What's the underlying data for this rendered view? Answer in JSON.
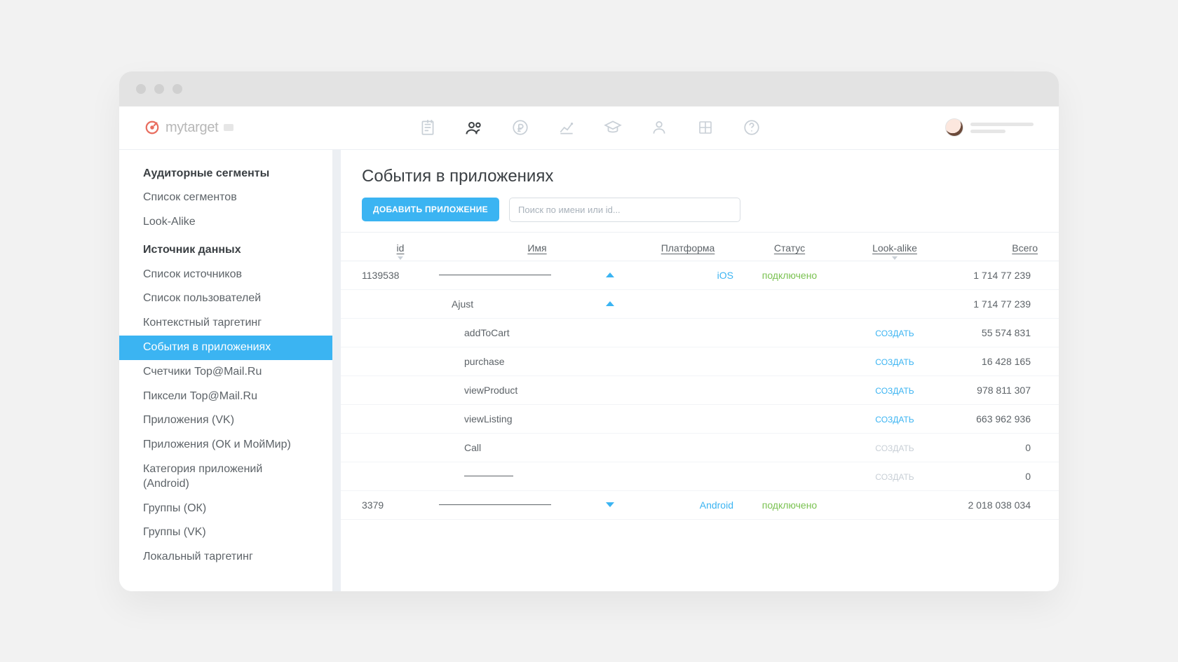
{
  "logo_text": "mytarget",
  "sidebar": {
    "sections": [
      {
        "header": "Аудиторные сегменты",
        "items": [
          "Список сегментов",
          "Look-Alike"
        ]
      },
      {
        "header": "Источник данных",
        "items": [
          "Список источников",
          "Список пользователей",
          "Контекстный таргетинг",
          "События в приложениях",
          "Счетчики Top@Mail.Ru",
          "Пиксели Top@Mail.Ru",
          "Приложения (VK)",
          "Приложения (ОК и МойМир)",
          "Категория приложений (Android)",
          "Группы (ОК)",
          "Группы (VK)",
          "Локальный таргетинг"
        ]
      }
    ],
    "active_item": "События в приложениях"
  },
  "page": {
    "title": "События в приложениях",
    "add_button_label": "ДОБАВИТЬ ПРИЛОЖЕНИЕ",
    "search_placeholder": "Поиск по имени или id..."
  },
  "table": {
    "columns": {
      "id": "id",
      "name": "Имя",
      "platform": "Платформа",
      "status": "Статус",
      "lookalike": "Look-alike",
      "total": "Всего"
    },
    "status_connected": "подключено",
    "create_label": "СОЗДАТЬ",
    "rows": [
      {
        "id": "1139538",
        "name": "",
        "name_line": true,
        "caret": "up",
        "platform": "iOS",
        "status": "подключено",
        "lookalike": "",
        "total": "1 714 77 239",
        "indent": 0
      },
      {
        "id": "",
        "name": "Ajust",
        "caret": "up",
        "platform": "",
        "status": "",
        "lookalike": "",
        "total": "1 714 77 239",
        "indent": 1
      },
      {
        "id": "",
        "name": "addToCart",
        "platform": "",
        "status": "",
        "lookalike": "create",
        "total": "55 574 831",
        "indent": 2
      },
      {
        "id": "",
        "name": "purchase",
        "platform": "",
        "status": "",
        "lookalike": "create",
        "total": "16 428 165",
        "indent": 2
      },
      {
        "id": "",
        "name": "viewProduct",
        "platform": "",
        "status": "",
        "lookalike": "create",
        "total": "978 811 307",
        "indent": 2
      },
      {
        "id": "",
        "name": "viewListing",
        "platform": "",
        "status": "",
        "lookalike": "create",
        "total": "663 962 936",
        "indent": 2
      },
      {
        "id": "",
        "name": "Call",
        "platform": "",
        "status": "",
        "lookalike": "create_disabled",
        "total": "0",
        "indent": 2
      },
      {
        "id": "",
        "name": "",
        "name_line_short": true,
        "platform": "",
        "status": "",
        "lookalike": "create_disabled",
        "total": "0",
        "indent": 2
      },
      {
        "id": "3379",
        "name": "",
        "name_line": true,
        "caret": "down",
        "platform": "Android",
        "status": "подключено",
        "lookalike": "",
        "total": "2 018 038 034",
        "indent": 0
      }
    ]
  }
}
